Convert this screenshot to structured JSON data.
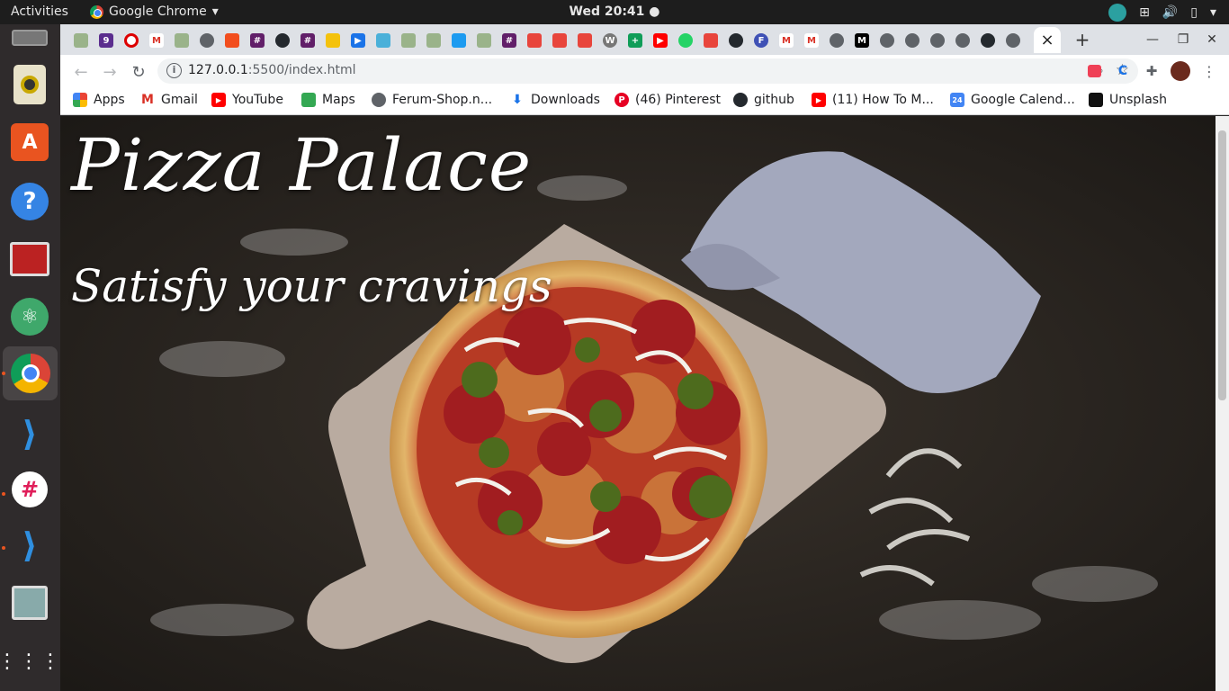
{
  "topbar": {
    "activities": "Activities",
    "app_name": "Google Chrome",
    "clock": "Wed 20:41"
  },
  "dock": {
    "items": [
      {
        "name": "files-icon"
      },
      {
        "name": "rhythmbox-icon"
      },
      {
        "name": "software-center-icon"
      },
      {
        "name": "help-icon"
      },
      {
        "name": "terminal-app-icon"
      },
      {
        "name": "atom-icon"
      },
      {
        "name": "chrome-icon"
      },
      {
        "name": "vscode-icon"
      },
      {
        "name": "slack-icon"
      },
      {
        "name": "vscode-window-icon"
      },
      {
        "name": "image-viewer-icon"
      },
      {
        "name": "show-apps-icon"
      }
    ]
  },
  "tabs": {
    "active_close_glyph": "×",
    "new_tab_glyph": "+"
  },
  "toolbar": {
    "url_host": "127.0.0.1",
    "url_path": ":5500/index.html"
  },
  "bookmarks": [
    {
      "label": "Apps",
      "icon": "apps-grid-icon",
      "color": "#4285f4"
    },
    {
      "label": "Gmail",
      "icon": "gmail-icon",
      "color": "#d93025"
    },
    {
      "label": "YouTube",
      "icon": "youtube-icon",
      "color": "#ff0000"
    },
    {
      "label": "Maps",
      "icon": "maps-icon",
      "color": "#34a853"
    },
    {
      "label": "Ferum-Shop.n...",
      "icon": "globe-icon",
      "color": "#5f6368"
    },
    {
      "label": "Downloads",
      "icon": "download-icon",
      "color": "#1a73e8"
    },
    {
      "label": "(46) Pinterest",
      "icon": "pinterest-icon",
      "color": "#e60023"
    },
    {
      "label": "github",
      "icon": "github-icon",
      "color": "#24292e"
    },
    {
      "label": "(11) How To M...",
      "icon": "youtube-icon",
      "color": "#ff0000"
    },
    {
      "label": "Google Calend...",
      "icon": "calendar-icon",
      "color": "#4285f4"
    },
    {
      "label": "Unsplash",
      "icon": "unsplash-icon",
      "color": "#111111"
    }
  ],
  "page": {
    "title": "Pizza Palace",
    "subtitle": "Satisfy your cravings"
  },
  "colors": {
    "accent": "#e95420",
    "tabstrip": "#dee1e6"
  }
}
